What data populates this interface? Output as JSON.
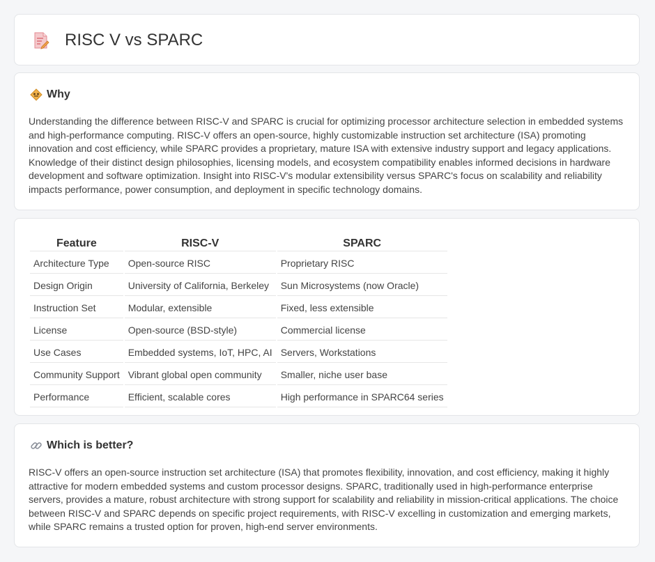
{
  "page": {
    "title": "RISC V vs SPARC"
  },
  "why": {
    "heading": "Why",
    "icon": "diamond-warning-icon",
    "text": "Understanding the difference between RISC-V and SPARC is crucial for optimizing processor architecture selection in embedded systems and high-performance computing. RISC-V offers an open-source, highly customizable instruction set architecture (ISA) promoting innovation and cost efficiency, while SPARC provides a proprietary, mature ISA with extensive industry support and legacy applications. Knowledge of their distinct design philosophies, licensing models, and ecosystem compatibility enables informed decisions in hardware development and software optimization. Insight into RISC-V's modular extensibility versus SPARC's focus on scalability and reliability impacts performance, power consumption, and deployment in specific technology domains."
  },
  "table": {
    "headers": [
      "Feature",
      "RISC-V",
      "SPARC"
    ],
    "rows": [
      [
        "Architecture Type",
        "Open-source RISC",
        "Proprietary RISC"
      ],
      [
        "Design Origin",
        "University of California, Berkeley",
        "Sun Microsystems (now Oracle)"
      ],
      [
        "Instruction Set",
        "Modular, extensible",
        "Fixed, less extensible"
      ],
      [
        "License",
        "Open-source (BSD-style)",
        "Commercial license"
      ],
      [
        "Use Cases",
        "Embedded systems, IoT, HPC, AI",
        "Servers, Workstations"
      ],
      [
        "Community Support",
        "Vibrant global open community",
        "Smaller, niche user base"
      ],
      [
        "Performance",
        "Efficient, scalable cores",
        "High performance in SPARC64 series"
      ]
    ]
  },
  "better": {
    "heading": "Which is better?",
    "icon": "link-icon",
    "text": "RISC-V offers an open-source instruction set architecture (ISA) that promotes flexibility, innovation, and cost efficiency, making it highly attractive for modern embedded systems and custom processor designs. SPARC, traditionally used in high-performance enterprise servers, provides a mature, robust architecture with strong support for scalability and reliability in mission-critical applications. The choice between RISC-V and SPARC depends on specific project requirements, with RISC-V excelling in customization and emerging markets, while SPARC remains a trusted option for proven, high-end server environments."
  },
  "colors": {
    "background": "#f5f6f8",
    "card": "#ffffff",
    "text": "#333333",
    "icon_accent": "#e8a23a",
    "doc_icon_pink": "#e9747a"
  }
}
